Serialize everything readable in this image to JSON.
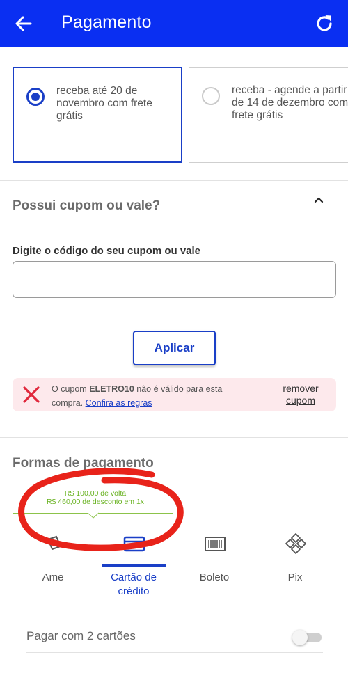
{
  "header": {
    "title": "Pagamento",
    "back_icon": "arrow-left-icon",
    "refresh_icon": "refresh-icon"
  },
  "shipping": {
    "options": [
      {
        "label": "receba até 20 de novembro com frete grátis",
        "selected": true
      },
      {
        "label": "receba - agende a partir de 14 de dezembro com frete grátis",
        "selected": false
      }
    ]
  },
  "coupon": {
    "title": "Possui cupom ou vale?",
    "expanded": true,
    "field_label": "Digite o código do seu cupom ou vale",
    "field_value": "",
    "apply_label": "Aplicar",
    "error": {
      "prefix": "O cupom ",
      "code": "ELETRO10",
      "suffix": " não é válido para esta compra. ",
      "link_text": "Confira as regras",
      "remove_label": "remover cupom"
    }
  },
  "payment": {
    "title": "Formas de pagamento",
    "promo_line1": "R$ 100,00 de volta",
    "promo_line2": "R$ 460,00 de desconto em 1x",
    "methods": [
      {
        "label": "Ame",
        "icon": "ame-icon",
        "active": false
      },
      {
        "label": "Cartão de crédito",
        "icon": "credit-card-icon",
        "active": true
      },
      {
        "label": "Boleto",
        "icon": "barcode-icon",
        "active": false
      },
      {
        "label": "Pix",
        "icon": "pix-icon",
        "active": false
      }
    ],
    "two_cards_label": "Pagar com 2 cartões",
    "two_cards_enabled": false
  },
  "colors": {
    "brand": "#0a2ff2",
    "accent": "#1a3fc7",
    "error_bg": "#fde9ec",
    "error_icon": "#e0283c",
    "promo": "#6ab323",
    "annotation": "#e8231a"
  }
}
